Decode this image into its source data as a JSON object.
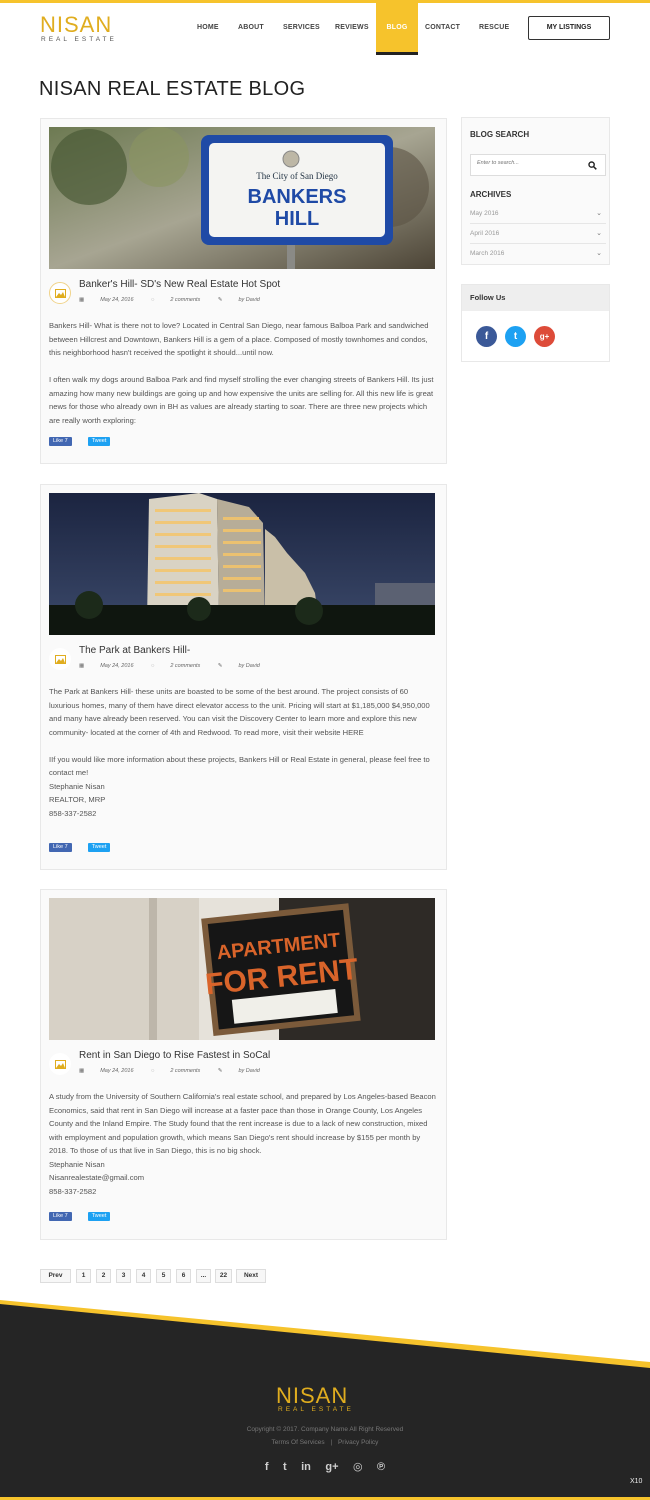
{
  "brand": {
    "logo_word": "NISAN",
    "logo_sub": "REAL ESTATE",
    "accent": "#f6c32c"
  },
  "nav": {
    "items": [
      "HOME",
      "ABOUT",
      "SERVICES",
      "REVIEWS",
      "BLOG",
      "CONTACT",
      "RESCUE"
    ],
    "active": "BLOG",
    "listings_button": "MY LISTINGS"
  },
  "page_title": "NISAN REAL ESTATE BLOG",
  "posts": [
    {
      "title": "Banker's Hill- SD's New Real Estate Hot Spot",
      "date": "May 24, 2016",
      "comments": "2 comments",
      "author": "by David",
      "image_sign": {
        "line1": "The City of San Diego",
        "line2": "BANKERS",
        "line3": "HILL"
      },
      "paragraphs": [
        "Bankers Hill- What is there not to love? Located in Central San Diego, near famous Balboa Park and sandwiched between Hillcrest and Downtown, Bankers Hill is a gem of a place. Composed of mostly townhomes and condos, this neighborhood hasn't received the spotlight it should...until now.",
        "",
        "I often walk my dogs around Balboa Park and find myself strolling the ever changing streets of Bankers Hill. Its just amazing how many new buildings are going up and how expensive the units are selling for. All this new life is great news for those who already own in BH as values are already starting to soar. There are three new projects which are really worth exploring:"
      ],
      "like": "Like 7",
      "tweet": "Tweet"
    },
    {
      "title": "The Park at Bankers Hill-",
      "date": "May 24, 2016",
      "comments": "2 comments",
      "author": "by David",
      "paragraphs": [
        "The Park at Bankers Hill- these units are boasted to be some of the best around. The project consists of 60 luxurious homes, many of them have direct elevator access to the unit. Pricing will start at $1,185,000 $4,950,000 and many have already been reserved. You can visit the Discovery Center to learn more and explore this new community- located at the corner of 4th and Redwood. To read more, visit their website HERE",
        "",
        "IIf you would like more information about these projects, Bankers Hill or Real Estate in general, please feel free to contact me!",
        "Stephanie Nisan",
        "REALTOR, MRP",
        "858-337-2582"
      ],
      "like": "Like 7",
      "tweet": "Tweet"
    },
    {
      "title": "Rent in San Diego to Rise Fastest in SoCal",
      "date": "May 24, 2016",
      "comments": "2 comments",
      "author": "by David",
      "image_sign": {
        "line1": "APARTMENT",
        "line2": "FOR RENT"
      },
      "paragraphs": [
        "A study from the University of Southern California's real estate school, and prepared by Los Angeles-based Beacon Economics, said that rent in San Diego will increase at a faster pace than those in Orange County, Los Angeles County and the Inland Empire. The Study found that the rent increase is due to a lack of new construction, mixed with employment and population growth, which means San Diego's rent should increase by $155 per month by 2018. To those of us that live in San Diego, this is no big shock.",
        "Stephanie Nisan",
        "Nisanrealestate@gmail.com",
        "858-337-2582"
      ],
      "like": "Like 7",
      "tweet": "Tweet"
    }
  ],
  "sidebar": {
    "search_title": "BLOG SEARCH",
    "search_placeholder": "Enter to search...",
    "archives_title": "ARCHIVES",
    "archives": [
      "May 2016",
      "April 2016",
      "March 2016"
    ],
    "follow_title": "Follow Us",
    "follow_icons": [
      {
        "glyph": "f",
        "color": "#3b5998"
      },
      {
        "glyph": "t",
        "color": "#1da1f2"
      },
      {
        "glyph": "g+",
        "color": "#dd4b39"
      }
    ]
  },
  "pagination": [
    "Prev",
    "1",
    "2",
    "3",
    "4",
    "5",
    "6",
    "...",
    "22",
    "Next"
  ],
  "footer": {
    "copyright": "Copyright © 2017. Company Name All Right Reserved",
    "terms": "Terms Of Services",
    "separator": "|",
    "privacy": "Privacy Policy",
    "icons": [
      "f",
      "t",
      "in",
      "g+",
      "◎",
      "℗"
    ],
    "corner": "X10"
  }
}
